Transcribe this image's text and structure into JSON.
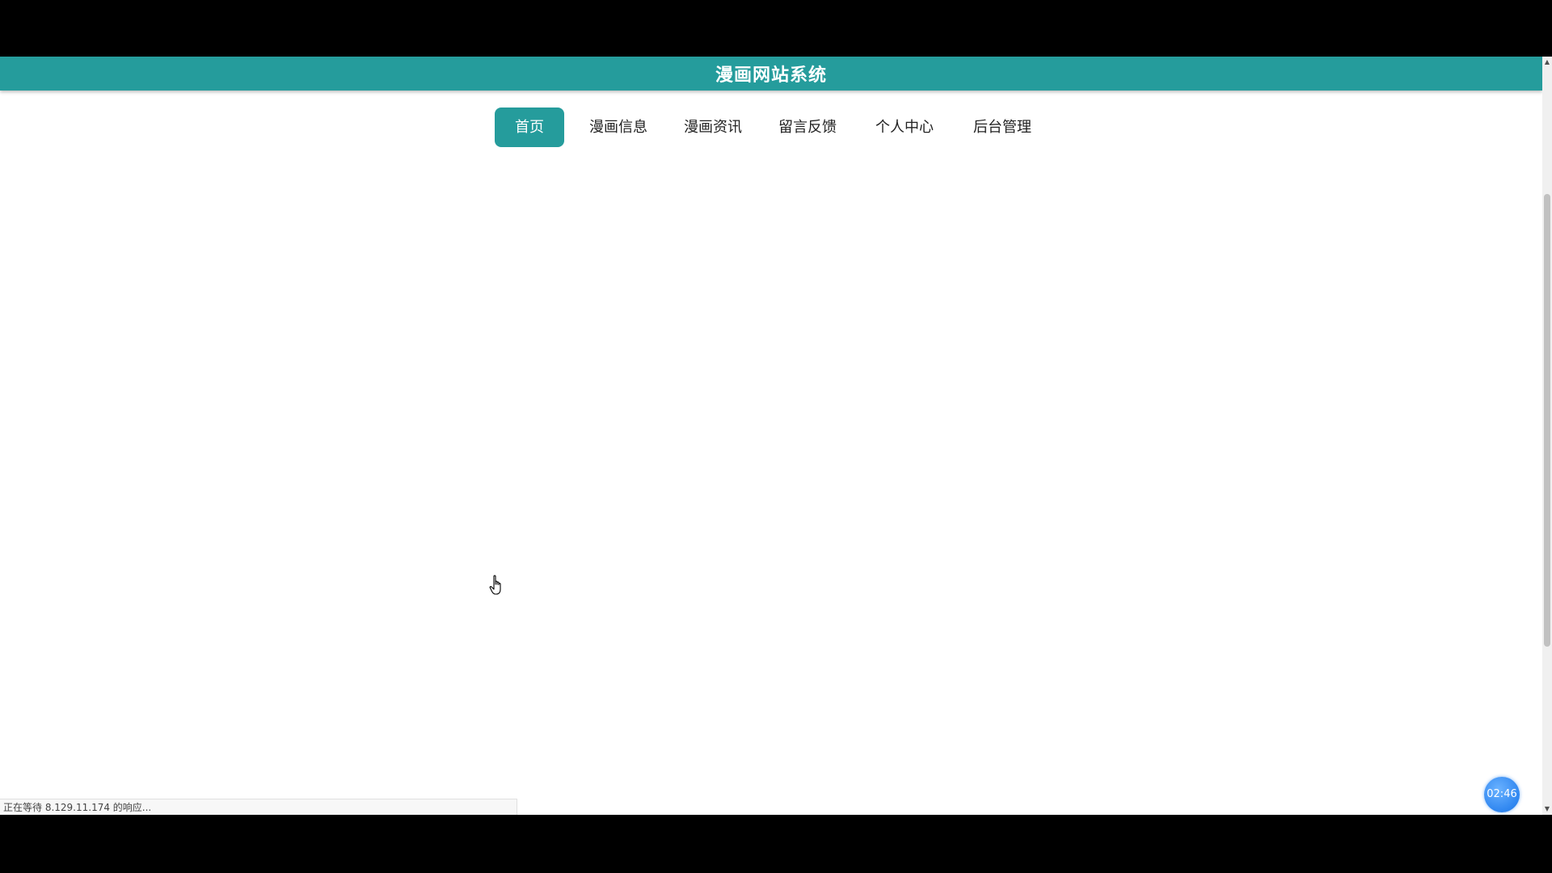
{
  "header": {
    "title": "漫画网站系统",
    "background_color": "#259c9c"
  },
  "nav": {
    "items": [
      {
        "label": "首页",
        "active": true
      },
      {
        "label": "漫画信息",
        "active": false
      },
      {
        "label": "漫画资讯",
        "active": false
      },
      {
        "label": "留言反馈",
        "active": false
      },
      {
        "label": "个人中心",
        "active": false
      },
      {
        "label": "后台管理",
        "active": false
      }
    ],
    "active_color": "#259c9c"
  },
  "status_bar": {
    "text": "正在等待 8.129.11.174 的响应..."
  },
  "timer_badge": {
    "text": "02:46",
    "color": "#2f86f0"
  },
  "cursor": {
    "icon": "hand-pointer-icon"
  },
  "scrollbar": {
    "up_icon": "scroll-up-arrow-icon",
    "down_icon": "scroll-down-arrow-icon"
  }
}
